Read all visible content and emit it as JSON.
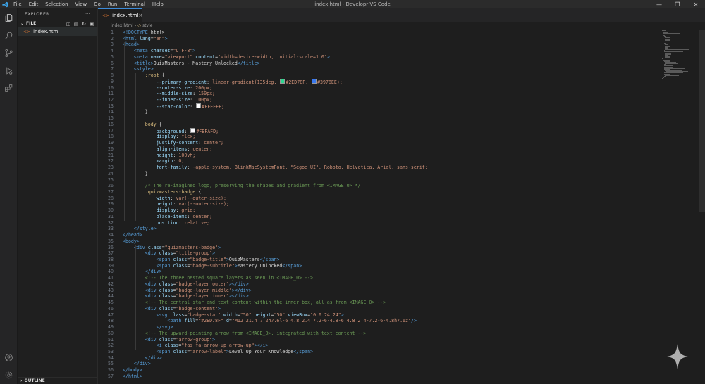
{
  "menu": [
    "File",
    "Edit",
    "Selection",
    "View",
    "Go",
    "Run",
    "Terminal",
    "Help"
  ],
  "window_title": "index.html - Developr VS Code",
  "sidebar": {
    "header": "EXPLORER",
    "more": "···",
    "section": "FILE",
    "files": [
      "index.html"
    ],
    "outline": "OUTLINE"
  },
  "tab": {
    "label": "index.html",
    "close": "×"
  },
  "breadcrumb": [
    "index.html",
    "style"
  ],
  "code_lines": [
    "<!DOCTYPE html>",
    "<html lang=\"en\">",
    "<head>",
    "    <meta charset=\"UTF-8\">",
    "    <meta name=\"viewport\" content=\"width=device-width, initial-scale=1.0\">",
    "    <title>QuizMasters - Mastery Unlocked</title>",
    "    <style>",
    "        :root {",
    "            --primary-gradient: linear-gradient(135deg, #2ED78F, #3978EE);",
    "            --outer-size: 200px;",
    "            --middle-size: 150px;",
    "            --inner-size: 100px;",
    "            --star-color: #FFFFFF;",
    "        }",
    "",
    "        body {",
    "            background: #FBFAFD;",
    "            display: flex;",
    "            justify-content: center;",
    "            align-items: center;",
    "            height: 100vh;",
    "            margin: 0;",
    "            font-family: -apple-system, BlinkMacSystemFont, \"Segoe UI\", Roboto, Helvetica, Arial, sans-serif;",
    "        }",
    "",
    "        /* The re-imagined logo, preserving the shapes and gradient from <IMAGE_0> */",
    "        .quizmasters-badge {",
    "            width: var(--outer-size);",
    "            height: var(--outer-size);",
    "            display: grid;",
    "            place-items: center;",
    "            position: relative;",
    "    </style>",
    "</head>",
    "<body>",
    "    <div class=\"quizmasters-badge\">",
    "        <div class=\"title-group\">",
    "            <span class=\"badge-title\">QuizMasters</span>",
    "            <span class=\"badge-subtitle\">Mastery Unlocked</span>",
    "        </div>",
    "        <!-- The three nested square layers as seen in <IMAGE_0> -->",
    "        <div class=\"badge-layer outer\"></div>",
    "        <div class=\"badge-layer middle\"></div>",
    "        <div class=\"badge-layer inner\"></div>",
    "        <!-- The central star and text content within the inner box, all as from <IMAGE_0> -->",
    "        <div class=\"badge-content\">",
    "            <svg class=\"badge-star\" width=\"50\" height=\"50\" viewBox=\"0 0 24 24\">",
    "                <path fill=\"#2ED78F\" d=\"M12 21.4 7.2h7.6l-6 4.8 2.4 7.2-6-4.8-6 4.8 2.4-7.2-6-4.8h7.6z\"/>",
    "            </svg>",
    "        <!-- The upward-pointing arrow from <IMAGE_0>, integrated with text content -->",
    "        <div class=\"arrow-group\">",
    "            <i class=\"fas fa-arrow-up arrow-up\"></i>",
    "            <span class=\"arrow-label\">Level Up Your Knowledge</span>",
    "        </div>",
    "    </div>",
    "</body>",
    "</html>"
  ],
  "colors": {
    "gradient_start": "#2ED78F",
    "gradient_end": "#3978EE",
    "star_color": "#FFFFFF",
    "background": "#FBFAFD"
  },
  "icons": [
    "vscode-logo-icon",
    "files-icon",
    "search-icon",
    "source-control-icon",
    "run-debug-icon",
    "extensions-icon",
    "account-icon",
    "settings-gear-icon",
    "sparkle-icon"
  ]
}
